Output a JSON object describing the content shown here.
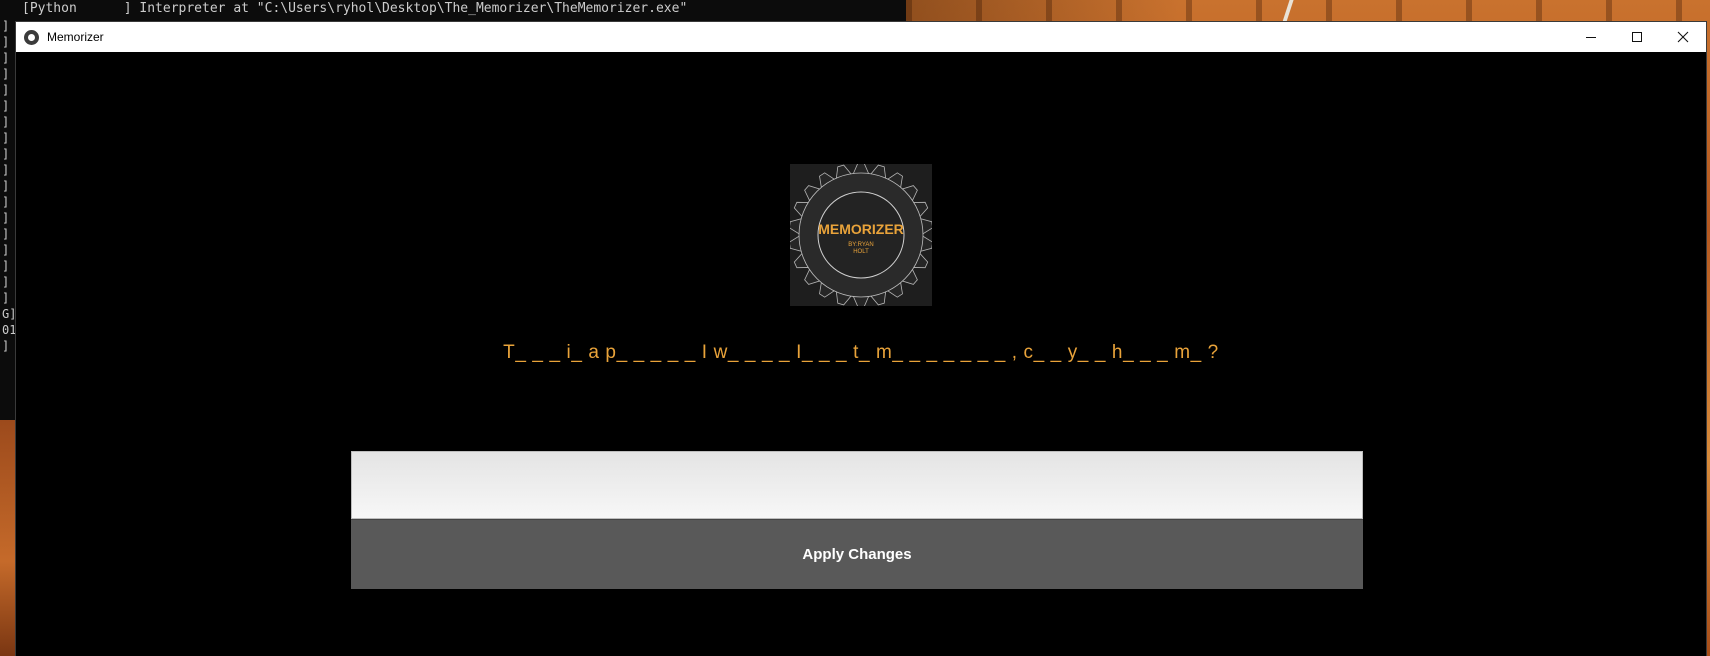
{
  "console": {
    "top_line": "[Python      ] Interpreter at \"C:\\Users\\ryhol\\Desktop\\The_Memorizer\\TheMemorizer.exe\"",
    "bracket_column": "]\n]\n]\n]\n]\n]\n]\n]\n]\n]\n]\n]\n]\n]\n]\n]\n]\n]\nG]\n01\n]"
  },
  "window": {
    "title": "Memorizer",
    "minimize_label": "—",
    "maximize_label": "☐",
    "close_label": "✕"
  },
  "logo": {
    "title": "MEMORIZER",
    "subtitle_line1": "BY:RYAN",
    "subtitle_line2": "HOLT",
    "accent_color": "#e9a33a"
  },
  "main": {
    "prompt": "T_ _ _  i_  a p_ _ _ _ _  I w_ _ _ _  I_ _ _  t_  m_ _ _ _ _ _ _ , c_ _  y_ _  h_ _ _  m_ ?",
    "answer_value": "",
    "apply_label": "Apply Changes"
  },
  "colors": {
    "prompt": "#e9a33a",
    "button_bg": "#595959",
    "window_bg": "#000000"
  }
}
